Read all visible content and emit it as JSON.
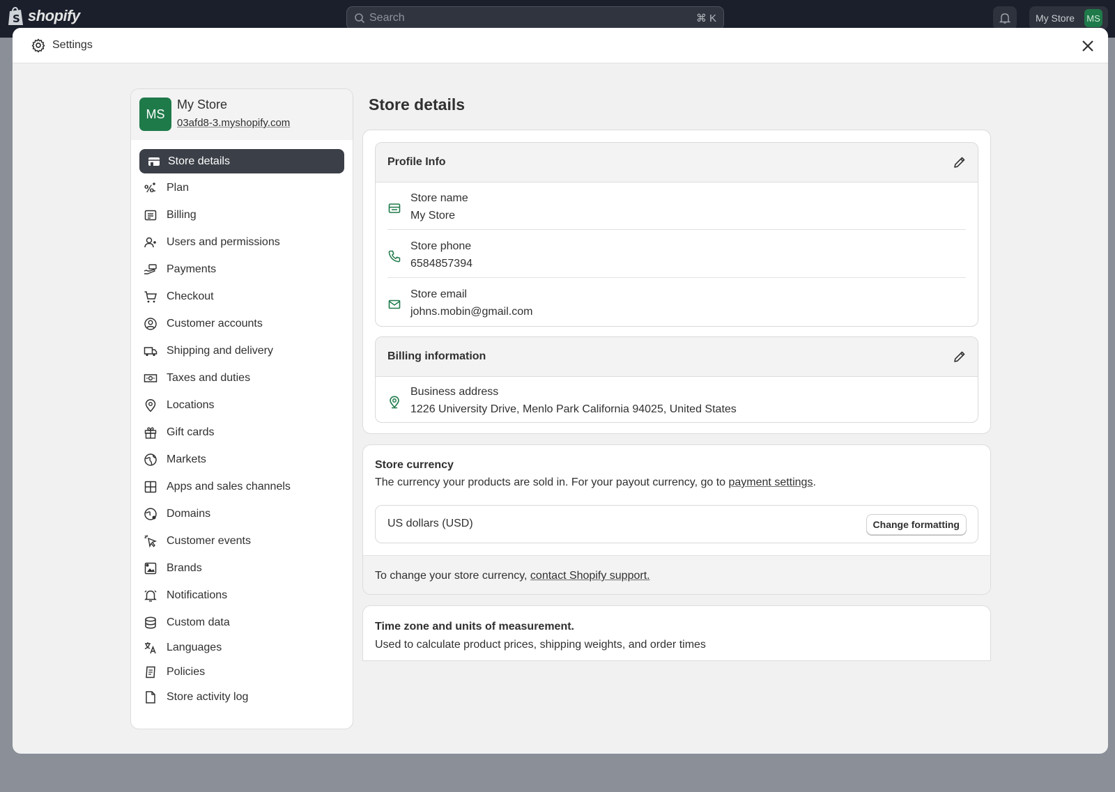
{
  "topbar": {
    "brand": "shopify",
    "search_placeholder": "Search",
    "search_shortcut": "⌘ K",
    "store_label": "My Store",
    "avatar_initials": "MS"
  },
  "modal": {
    "title": "Settings"
  },
  "store": {
    "initials": "MS",
    "name": "My Store",
    "url": "03afd8-3.myshopify.com"
  },
  "nav": {
    "items": [
      {
        "label": "Store details",
        "icon": "store-icon"
      },
      {
        "label": "Plan",
        "icon": "plan-icon"
      },
      {
        "label": "Billing",
        "icon": "billing-icon"
      },
      {
        "label": "Users and permissions",
        "icon": "users-icon"
      },
      {
        "label": "Payments",
        "icon": "payments-icon"
      },
      {
        "label": "Checkout",
        "icon": "cart-icon"
      },
      {
        "label": "Customer accounts",
        "icon": "customer-icon"
      },
      {
        "label": "Shipping and delivery",
        "icon": "truck-icon"
      },
      {
        "label": "Taxes and duties",
        "icon": "tax-icon"
      },
      {
        "label": "Locations",
        "icon": "location-icon"
      },
      {
        "label": "Gift cards",
        "icon": "gift-icon"
      },
      {
        "label": "Markets",
        "icon": "globe-icon"
      },
      {
        "label": "Apps and sales channels",
        "icon": "apps-icon"
      },
      {
        "label": "Domains",
        "icon": "domain-icon"
      },
      {
        "label": "Customer events",
        "icon": "cursor-icon"
      },
      {
        "label": "Brands",
        "icon": "brand-icon"
      },
      {
        "label": "Notifications",
        "icon": "bell-icon"
      },
      {
        "label": "Custom data",
        "icon": "database-icon"
      },
      {
        "label": "Languages",
        "icon": "language-icon"
      },
      {
        "label": "Policies",
        "icon": "policy-icon"
      },
      {
        "label": "Store activity log",
        "icon": "file-icon"
      }
    ]
  },
  "main": {
    "page_title": "Store details",
    "profile": {
      "heading": "Profile Info",
      "store_name_label": "Store name",
      "store_name_value": "My Store",
      "phone_label": "Store phone",
      "phone_value": "6584857394",
      "email_label": "Store email",
      "email_value": "johns.mobin@gmail.com"
    },
    "billing": {
      "heading": "Billing information",
      "address_label": "Business address",
      "address_value": "1226 University Drive, Menlo Park California 94025, United States"
    },
    "currency": {
      "heading": "Store currency",
      "desc_prefix": "The currency your products are sold in. For your payout currency, go to ",
      "desc_link": "payment settings",
      "desc_suffix": ".",
      "value": "US dollars (USD)",
      "button": "Change formatting",
      "foot_prefix": "To change your store currency, ",
      "foot_link": "contact Shopify support."
    },
    "timezone": {
      "heading": "Time zone and units of measurement.",
      "desc": "Used to calculate product prices, shipping weights, and order times"
    }
  },
  "colors": {
    "brand_green": "#1f7a4a",
    "active_nav": "#3b3f47",
    "topbar": "#1a1f2b"
  }
}
